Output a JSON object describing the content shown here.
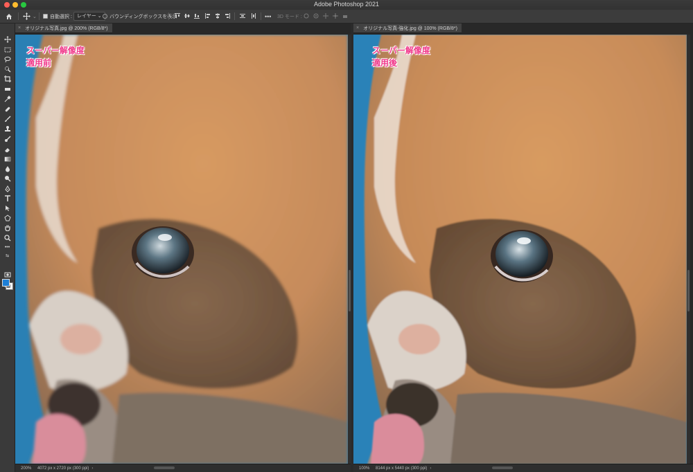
{
  "window": {
    "title": "Adobe Photoshop 2021"
  },
  "options_bar": {
    "auto_select_label": "自動選択 :",
    "auto_select_target": "レイヤー",
    "transform_controls_label": "バウンディングボックスを表示",
    "mode_3d_label": "3D モード :"
  },
  "documents": [
    {
      "tab_title": "オリジナル写真.jpg @ 200% (RGB/8*)",
      "overlay_line1": "スーパー解像度",
      "overlay_line2": "適用前",
      "zoom": "200%",
      "info": "4072 px x 2720 px (300 ppi)"
    },
    {
      "tab_title": "オリジナル写真-強化.jpg @ 100% (RGB/8*)",
      "overlay_line1": "スーパー解像度",
      "overlay_line2": "適用後",
      "zoom": "100%",
      "info": "8144 px x 5440 px (300 ppi)"
    }
  ],
  "toolbar": {
    "tools": [
      "move-tool",
      "marquee-tool",
      "lasso-tool",
      "quick-select-tool",
      "crop-tool",
      "frame-tool",
      "eyedropper-tool",
      "healing-brush-tool",
      "brush-tool",
      "clone-stamp-tool",
      "history-brush-tool",
      "eraser-tool",
      "gradient-tool",
      "blur-tool",
      "dodge-tool",
      "pen-tool",
      "type-tool",
      "path-select-tool",
      "shape-tool",
      "hand-tool",
      "zoom-tool",
      "more-tools"
    ],
    "foreground_color": "#1e7fd6",
    "background_color": "#ffffff"
  },
  "colors": {
    "overlay_text": "#f0388a",
    "ui_dark": "#2b2b2b"
  }
}
